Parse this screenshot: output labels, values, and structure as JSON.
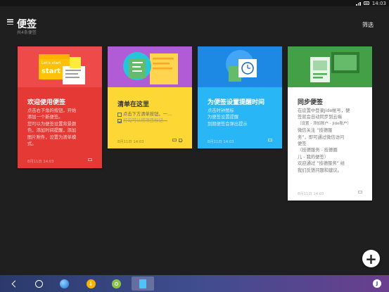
{
  "status_bar": {
    "time": "14:03"
  },
  "app": {
    "title": "便签",
    "subtitle": "共4条便签",
    "filter_label": "筛选"
  },
  "cards": [
    {
      "id": "welcome",
      "title": "欢迎使用便签",
      "body": [
        "点击右下角的按钮，开始",
        "添加一个新便签。",
        "您可以为便签设置背景颜",
        "色，添加时间提醒，添加",
        "图片附件，设置为清单模",
        "式。"
      ],
      "date": "8月11日 14:03",
      "hero_badge": "Let's start",
      "hero_start": "start",
      "colors": {
        "hero": "#ef4a4a",
        "body": "#e53935",
        "text": "#ffffff"
      }
    },
    {
      "id": "checklist",
      "title": "清单在这里",
      "items": [
        {
          "text": "点击下方清单按钮，一…",
          "done": false
        },
        {
          "text": "打勾可以将项目标记…",
          "done": true
        }
      ],
      "date": "8月11日 14:03",
      "colors": {
        "hero": "#b15bd6",
        "body": "#fdd835",
        "text": "#333333"
      }
    },
    {
      "id": "reminder",
      "title": "为便签设置提醒时间",
      "body": [
        "点击时钟图标",
        "为便签设置提醒",
        "到期便签会弹出提示"
      ],
      "date": "8月11日 14:03",
      "colors": {
        "hero": "#1e88e5",
        "body": "#29b6f6",
        "text": "#ffffff"
      }
    },
    {
      "id": "sync",
      "title": "同步便签",
      "body": [
        "在设置中登录Jide帐号，便",
        "签就会自动同步到云端",
        "（设置 - 添加账户 - Jide账户）",
        "微信关注 “技德服",
        "务”，即可通过微信访问",
        "便签",
        "（技德服务 - 技德圈",
        "儿 - 我的便签）",
        "欢迎通过 “技德服务” 给",
        "我们反馈问题和建议。"
      ],
      "date": "8月11日 14:03",
      "colors": {
        "hero": "#43a047",
        "body": "#ffffff",
        "text": "#444444"
      }
    }
  ],
  "fab": {
    "label": "+"
  },
  "nav": {
    "apps": [
      "browser-app",
      "download-app",
      "search-app",
      "notes-app"
    ],
    "accent": "#3f4d8f"
  }
}
